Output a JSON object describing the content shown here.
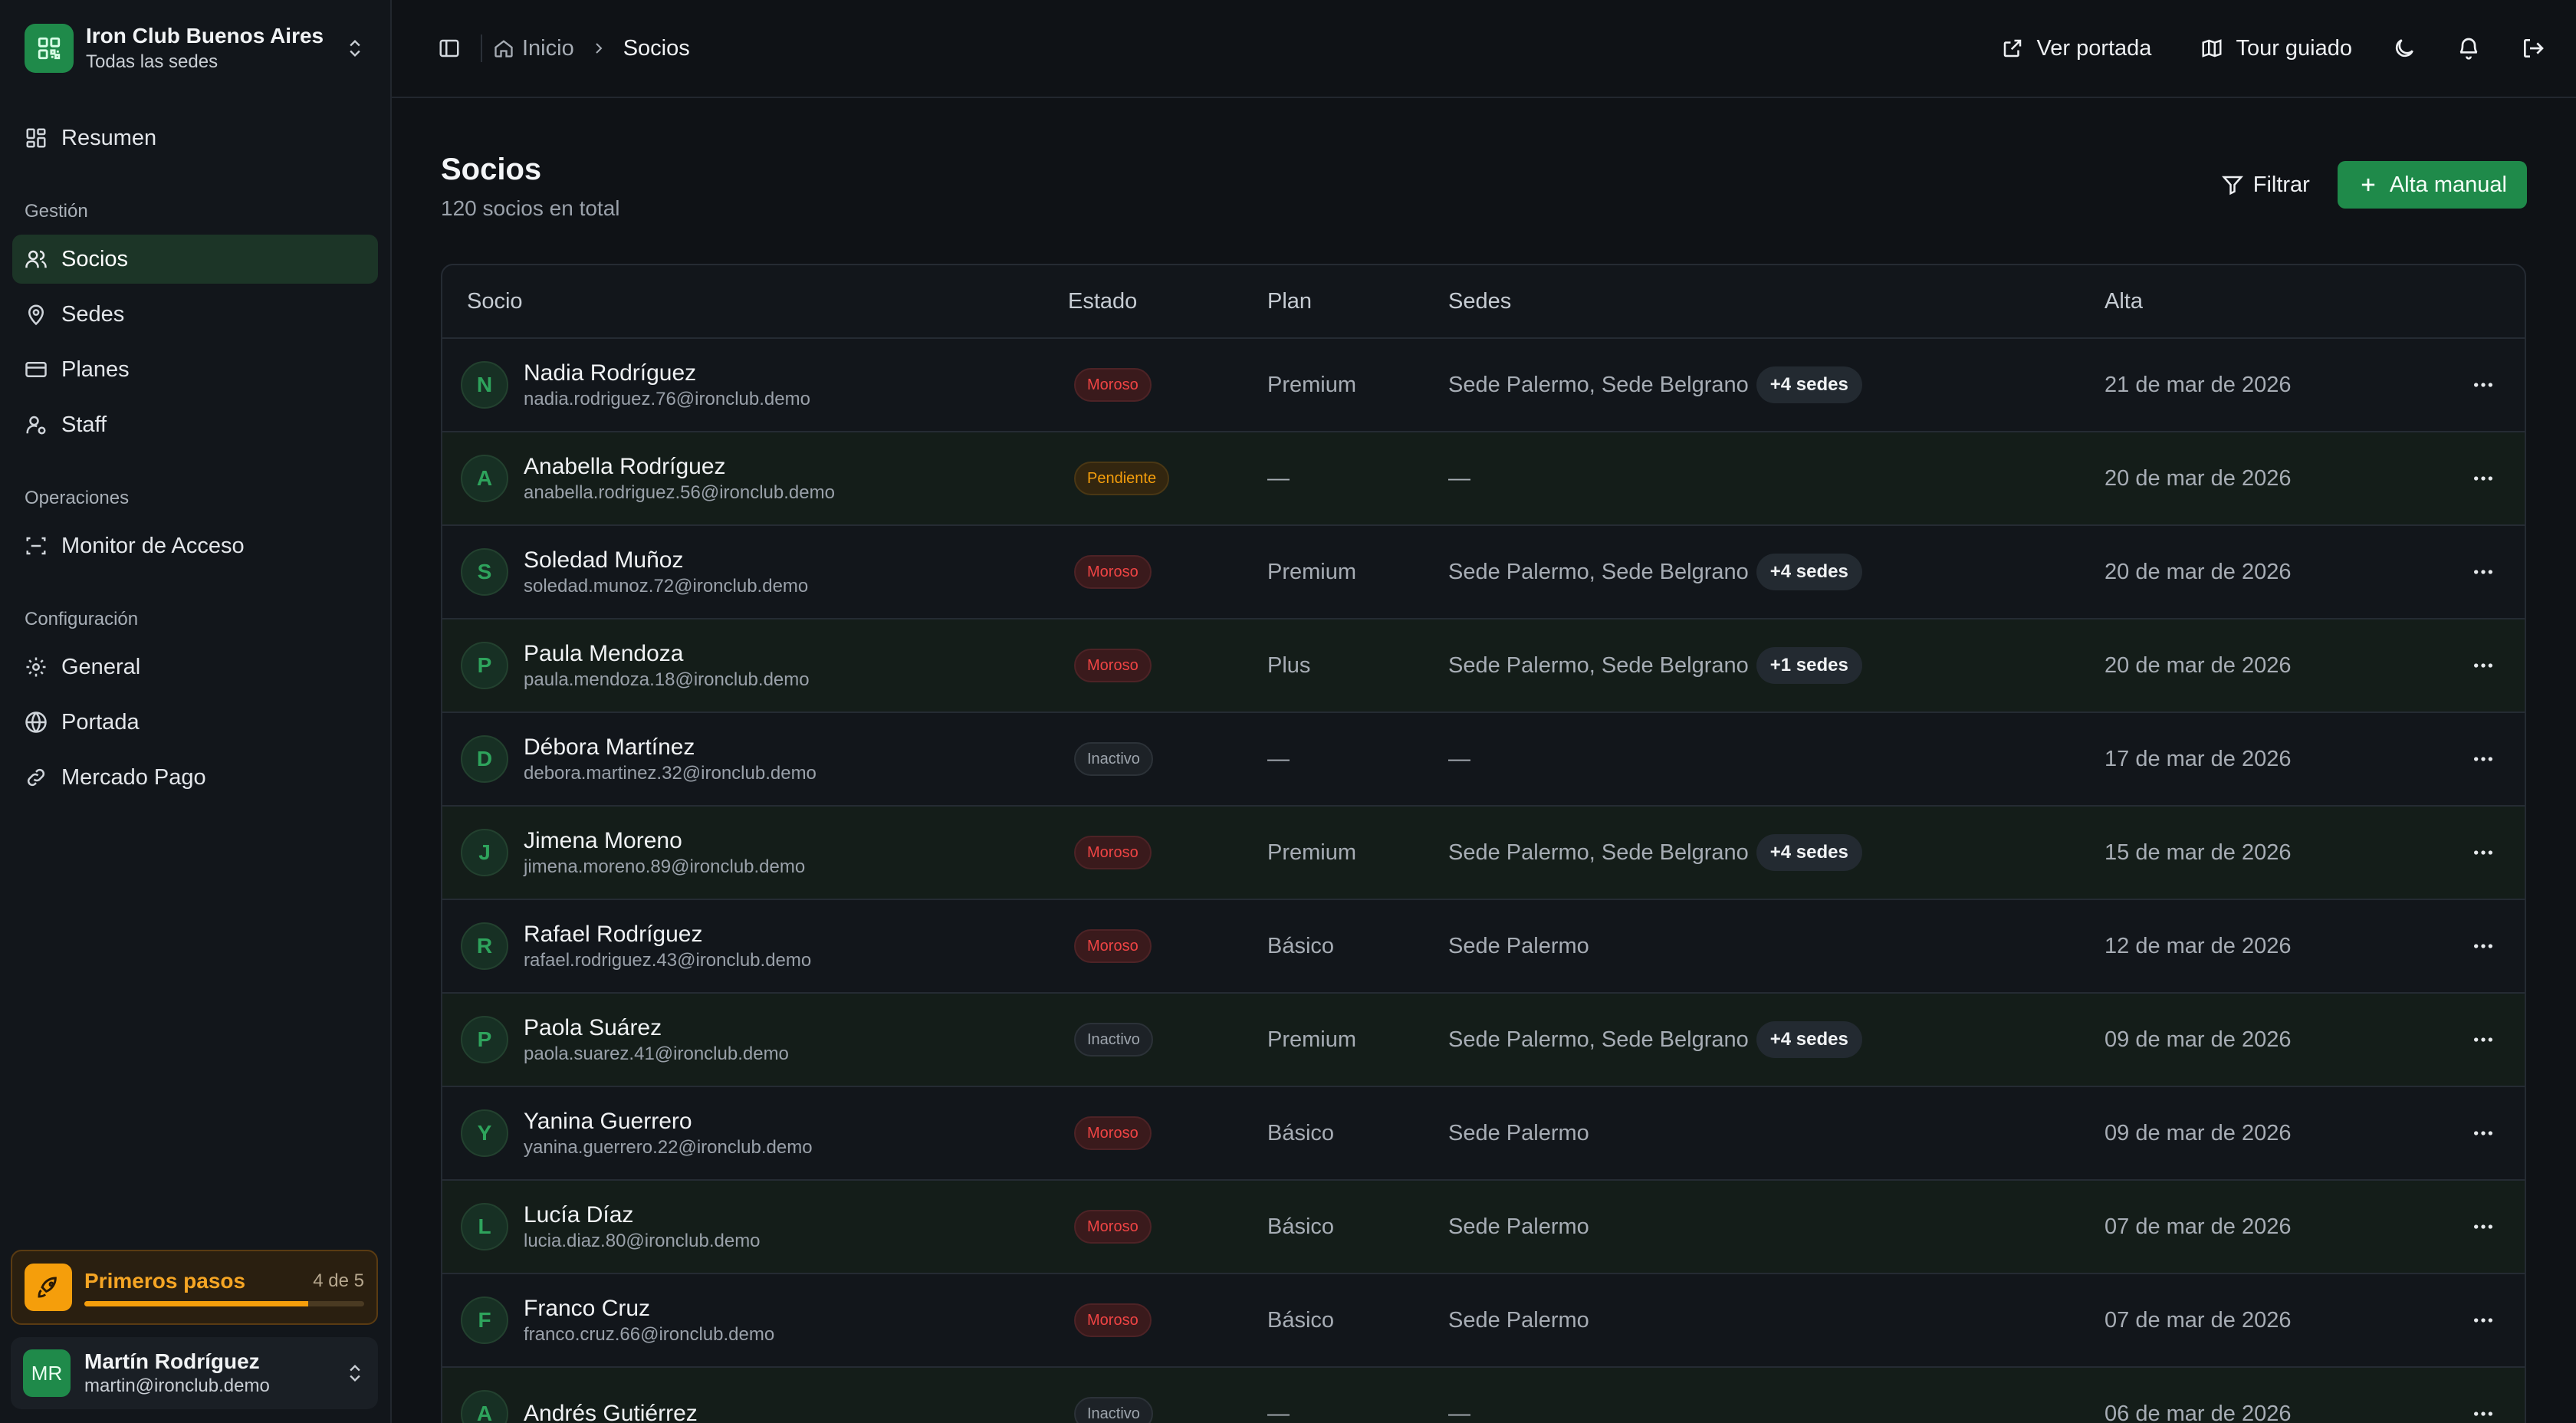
{
  "org": {
    "name": "Iron Club Buenos Aires",
    "subtitle": "Todas las sedes"
  },
  "nav": {
    "summary": "Resumen",
    "section_gestion": "Gestión",
    "socios": "Socios",
    "sedes": "Sedes",
    "planes": "Planes",
    "staff": "Staff",
    "section_operaciones": "Operaciones",
    "monitor": "Monitor de Acceso",
    "section_config": "Configuración",
    "general": "General",
    "portada": "Portada",
    "mercado_pago": "Mercado Pago"
  },
  "onboarding": {
    "title": "Primeros pasos",
    "count": "4 de 5",
    "progress_fraction": 0.8
  },
  "user": {
    "initials": "MR",
    "name": "Martín Rodríguez",
    "email": "martin@ironclub.demo"
  },
  "breadcrumb": {
    "home": "Inicio",
    "current": "Socios"
  },
  "topbar": {
    "ver_portada": "Ver portada",
    "tour": "Tour guiado"
  },
  "page": {
    "title": "Socios",
    "subtitle": "120 socios en total",
    "filter_label": "Filtrar",
    "add_label": "Alta manual"
  },
  "table": {
    "headers": {
      "socio": "Socio",
      "estado": "Estado",
      "plan": "Plan",
      "sedes": "Sedes",
      "alta": "Alta"
    },
    "rows": [
      {
        "initial": "N",
        "name": "Nadia Rodríguez",
        "email": "nadia.rodriguez.76@ironclub.demo",
        "status": "Moroso",
        "status_kind": "moroso",
        "plan": "Premium",
        "sedes": "Sede Palermo, Sede Belgrano",
        "extra": "+4 sedes",
        "alta": "21 de mar de 2026"
      },
      {
        "initial": "A",
        "name": "Anabella Rodríguez",
        "email": "anabella.rodriguez.56@ironclub.demo",
        "status": "Pendiente",
        "status_kind": "pendiente",
        "plan": "—",
        "sedes": "—",
        "extra": "",
        "alta": "20 de mar de 2026"
      },
      {
        "initial": "S",
        "name": "Soledad Muñoz",
        "email": "soledad.munoz.72@ironclub.demo",
        "status": "Moroso",
        "status_kind": "moroso",
        "plan": "Premium",
        "sedes": "Sede Palermo, Sede Belgrano",
        "extra": "+4 sedes",
        "alta": "20 de mar de 2026"
      },
      {
        "initial": "P",
        "name": "Paula Mendoza",
        "email": "paula.mendoza.18@ironclub.demo",
        "status": "Moroso",
        "status_kind": "moroso",
        "plan": "Plus",
        "sedes": "Sede Palermo, Sede Belgrano",
        "extra": "+1 sedes",
        "alta": "20 de mar de 2026"
      },
      {
        "initial": "D",
        "name": "Débora Martínez",
        "email": "debora.martinez.32@ironclub.demo",
        "status": "Inactivo",
        "status_kind": "inactivo",
        "plan": "—",
        "sedes": "—",
        "extra": "",
        "alta": "17 de mar de 2026"
      },
      {
        "initial": "J",
        "name": "Jimena Moreno",
        "email": "jimena.moreno.89@ironclub.demo",
        "status": "Moroso",
        "status_kind": "moroso",
        "plan": "Premium",
        "sedes": "Sede Palermo, Sede Belgrano",
        "extra": "+4 sedes",
        "alta": "15 de mar de 2026"
      },
      {
        "initial": "R",
        "name": "Rafael Rodríguez",
        "email": "rafael.rodriguez.43@ironclub.demo",
        "status": "Moroso",
        "status_kind": "moroso",
        "plan": "Básico",
        "sedes": "Sede Palermo",
        "extra": "",
        "alta": "12 de mar de 2026"
      },
      {
        "initial": "P",
        "name": "Paola Suárez",
        "email": "paola.suarez.41@ironclub.demo",
        "status": "Inactivo",
        "status_kind": "inactivo",
        "plan": "Premium",
        "sedes": "Sede Palermo, Sede Belgrano",
        "extra": "+4 sedes",
        "alta": "09 de mar de 2026"
      },
      {
        "initial": "Y",
        "name": "Yanina Guerrero",
        "email": "yanina.guerrero.22@ironclub.demo",
        "status": "Moroso",
        "status_kind": "moroso",
        "plan": "Básico",
        "sedes": "Sede Palermo",
        "extra": "",
        "alta": "09 de mar de 2026"
      },
      {
        "initial": "L",
        "name": "Lucía Díaz",
        "email": "lucia.diaz.80@ironclub.demo",
        "status": "Moroso",
        "status_kind": "moroso",
        "plan": "Básico",
        "sedes": "Sede Palermo",
        "extra": "",
        "alta": "07 de mar de 2026"
      },
      {
        "initial": "F",
        "name": "Franco Cruz",
        "email": "franco.cruz.66@ironclub.demo",
        "status": "Moroso",
        "status_kind": "moroso",
        "plan": "Básico",
        "sedes": "Sede Palermo",
        "extra": "",
        "alta": "07 de mar de 2026"
      },
      {
        "initial": "A",
        "name": "Andrés Gutiérrez",
        "email": "",
        "status": "Inactivo",
        "status_kind": "inactivo",
        "plan": "—",
        "sedes": "—",
        "extra": "",
        "alta": "06 de mar de 2026"
      }
    ]
  },
  "colors": {
    "accent": "#1f8a4a",
    "moroso": "#ef4444",
    "pendiente": "#f59e0b",
    "inactivo": "#9ea5ad",
    "onboarding": "#f59e0b"
  },
  "icons": {
    "org": "qr-code-icon",
    "switcher": "chevrons-up-down-icon",
    "resumen": "layout-grid-icon",
    "socios": "users-icon",
    "sedes": "map-pin-icon",
    "planes": "credit-card-icon",
    "staff": "user-cog-icon",
    "monitor": "scan-icon",
    "general": "gear-icon",
    "portada": "globe-icon",
    "mercado_pago": "link-icon",
    "onboarding": "rocket-icon",
    "sidebar_toggle": "sidebar-toggle-icon",
    "home": "home-icon",
    "ver_portada": "external-link-icon",
    "tour": "map-icon",
    "theme": "moon-icon",
    "notifications": "bell-icon",
    "logout": "logout-icon",
    "filter": "filter-icon",
    "add": "plus-icon",
    "row_menu": "more-horizontal-icon"
  }
}
